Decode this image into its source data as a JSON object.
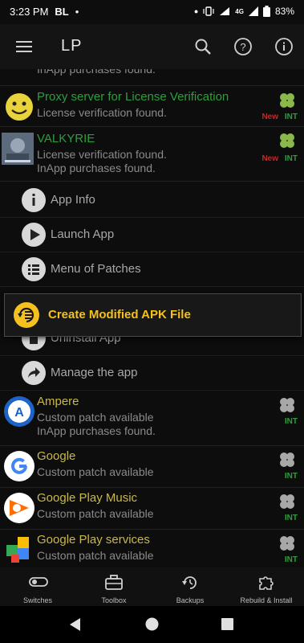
{
  "status_bar": {
    "time": "3:23 PM",
    "carrier": "BL",
    "dot": "•",
    "network": "4G",
    "battery": "83%"
  },
  "app_bar": {
    "title": "LP"
  },
  "rows": [
    {
      "title": "",
      "subtitles": [
        "InApp purchases found."
      ],
      "title_color": "#2e9e3d"
    },
    {
      "title": "Proxy server for License Verification",
      "subtitles": [
        "License verification found."
      ],
      "title_color": "#2e9e3d",
      "badge_new": "New",
      "badge_int": "INT"
    },
    {
      "title": "VALKYRIE",
      "subtitles": [
        "License verification found.",
        "InApp purchases found."
      ],
      "title_color": "#2e9e3d",
      "badge_new": "New",
      "badge_int": "INT"
    }
  ],
  "submenu": [
    {
      "label": "App Info",
      "icon": "info-icon"
    },
    {
      "label": "Launch App",
      "icon": "play-icon"
    },
    {
      "label": "Menu of Patches",
      "icon": "list-icon"
    },
    {
      "label": "Uninstall App",
      "icon": "trash-icon"
    },
    {
      "label": "Manage the app",
      "icon": "share-icon"
    }
  ],
  "popup": {
    "label": "Create Modified APK File"
  },
  "apps": [
    {
      "title": "Ampere",
      "subtitles": [
        "Custom patch available",
        "InApp purchases found."
      ],
      "badge_int": "INT"
    },
    {
      "title": "Google",
      "subtitles": [
        "Custom patch available"
      ],
      "badge_int": "INT"
    },
    {
      "title": "Google Play Music",
      "subtitles": [
        "Custom patch available"
      ],
      "badge_int": "INT"
    },
    {
      "title": "Google Play services",
      "subtitles": [
        "Custom patch available"
      ],
      "badge_int": "INT"
    }
  ],
  "bottom_nav": [
    {
      "label": "Switches",
      "icon": "toggle-icon"
    },
    {
      "label": "Toolbox",
      "icon": "toolbox-icon"
    },
    {
      "label": "Backups",
      "icon": "backup-icon"
    },
    {
      "label": "Rebuild & Install",
      "icon": "puzzle-icon"
    }
  ],
  "colors": {
    "green": "#2e9e3d",
    "yellow_title": "#c9b84a",
    "popup_text": "#f4c11f",
    "new_badge": "#c62828"
  }
}
